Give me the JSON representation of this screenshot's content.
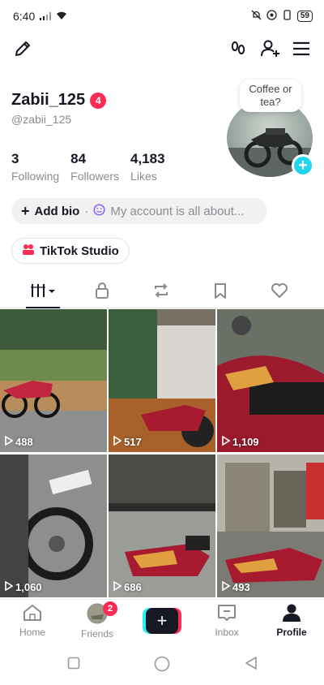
{
  "status_bar": {
    "time": "6:40",
    "battery": "59"
  },
  "note": {
    "text": "Coffee or tea?"
  },
  "profile": {
    "username": "Zabii_125",
    "notification_count": "4",
    "handle": "@zabii_125",
    "stats": [
      {
        "count": "3",
        "label": "Following"
      },
      {
        "count": "84",
        "label": "Followers"
      },
      {
        "count": "4,183",
        "label": "Likes"
      }
    ],
    "bio": {
      "add_label": "Add bio",
      "separator": "·",
      "hint": "My account is all about..."
    },
    "studio_label": "TikTok Studio"
  },
  "videos": [
    {
      "views": "488"
    },
    {
      "views": "517"
    },
    {
      "views": "1,109"
    },
    {
      "views": "1,060"
    },
    {
      "views": "686"
    },
    {
      "views": "493"
    }
  ],
  "bottom_nav": {
    "home": "Home",
    "friends": "Friends",
    "friends_badge": "2",
    "inbox": "Inbox",
    "profile": "Profile"
  },
  "colors": {
    "accent": "#fe2c55",
    "cyan": "#25f4ee",
    "text": "#161823",
    "muted": "#8a8b91"
  }
}
